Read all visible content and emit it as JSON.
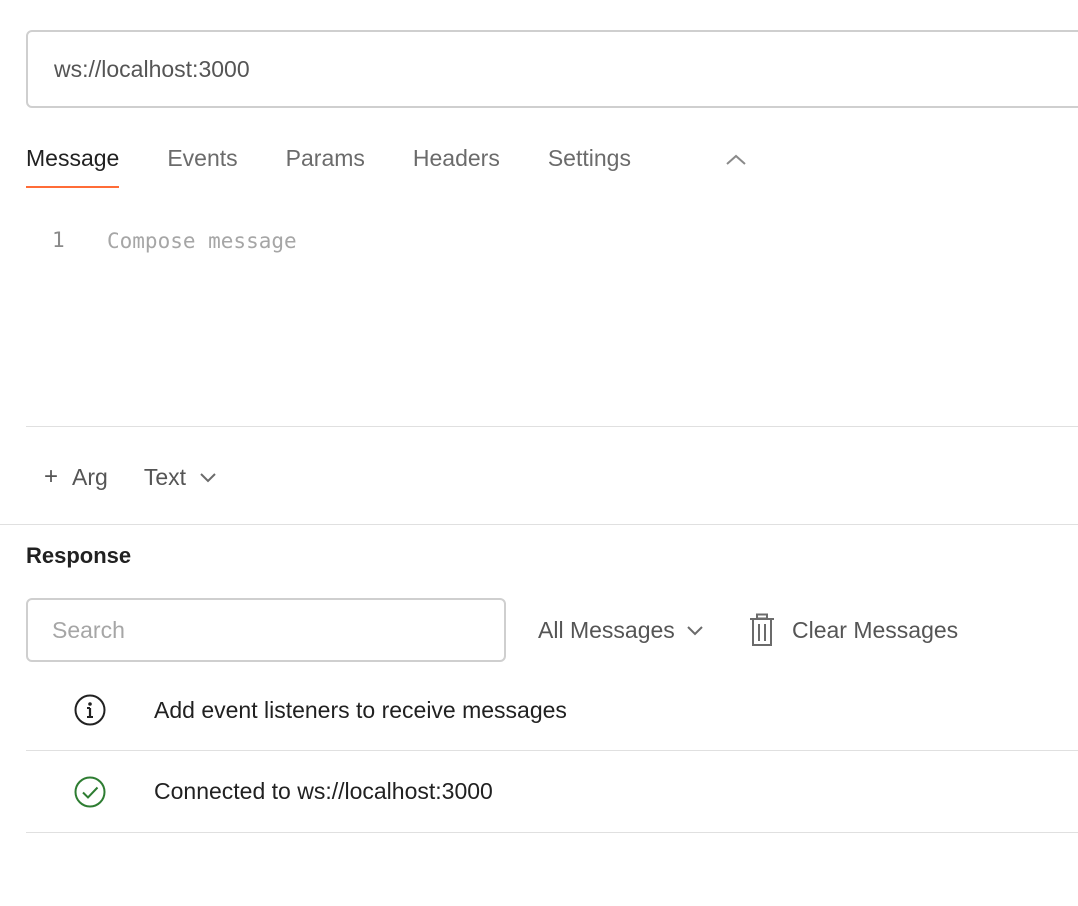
{
  "url_bar": {
    "value": "ws://localhost:3000"
  },
  "tabs": [
    {
      "label": "Message",
      "active": true
    },
    {
      "label": "Events",
      "active": false
    },
    {
      "label": "Params",
      "active": false
    },
    {
      "label": "Headers",
      "active": false
    },
    {
      "label": "Settings",
      "active": false
    }
  ],
  "collapse_icon": "chevron-up-icon",
  "editor": {
    "line_number": "1",
    "placeholder": "Compose message"
  },
  "toolbar": {
    "arg_prefix": "+",
    "arg_label": "Arg",
    "type_label": "Text"
  },
  "response": {
    "title": "Response",
    "search_placeholder": "Search",
    "filter_label": "All Messages",
    "clear_label": "Clear Messages",
    "messages": [
      {
        "icon": "info-icon",
        "text": "Add event listeners to receive messages"
      },
      {
        "icon": "check-circle-icon",
        "text": "Connected to ws://localhost:3000"
      }
    ]
  },
  "colors": {
    "accent": "#ff6c37",
    "success": "#2e7d32",
    "border": "#cfcfcf"
  }
}
